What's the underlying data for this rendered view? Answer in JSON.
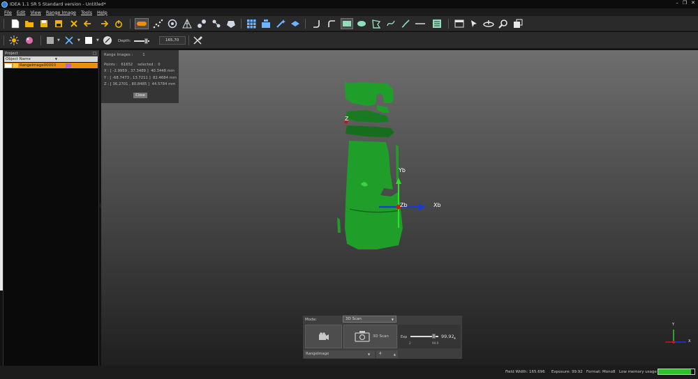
{
  "window": {
    "title": "IDEA 1.1 SR 5 Standard version - Untitled*"
  },
  "menu": [
    "File",
    "Edit",
    "View",
    "Range Image",
    "Tools",
    "Help"
  ],
  "toolbar2": {
    "depth_label": "Depth:",
    "depth_value": "165,70"
  },
  "project_panel": {
    "title": "Project",
    "column_header": "Object Name",
    "objects": [
      {
        "name": "RangeImage00003"
      }
    ]
  },
  "info_box": {
    "range_images_label": "Range Images :",
    "range_images_value": "1",
    "points_label": "Points :",
    "points_value": "61652",
    "selected_label": "selected :",
    "selected_value": "0",
    "x_line": "X : [ -2.9959 , 37.3489 ]",
    "x_size": "40.3448 mm",
    "y_line": "Y : [ -68.7473 , 13.7211 ]",
    "y_size": "82.4684 mm",
    "z_line": "Z : [ 36.2701 , 80.8485 ]",
    "z_size": "44.5784 mm",
    "close_label": "Close"
  },
  "viewport": {
    "axis_labels": {
      "z": "Z",
      "yb": "Yb",
      "zb": "Zb",
      "xb": "Xb"
    },
    "mini_axes": {
      "y": "Y",
      "x": "X"
    },
    "model_color": "#1f9e2a"
  },
  "scan_panel": {
    "mode_label": "Mode:",
    "mode_value": "3D Scan",
    "scan_button_label": "3D Scan",
    "exp_label": "Exp",
    "exp_value": "99,92",
    "exp_min": "2",
    "exp_max": "99.9",
    "exp_level": 0.82,
    "target_value": "RangeImage",
    "count_value": "4"
  },
  "status": {
    "field_width": "Field Width: 165.696",
    "exposure": "Exposure: 99.92",
    "format": "Format: Mono8",
    "memory": "Low memory usage",
    "memory_fill": 0.9
  }
}
